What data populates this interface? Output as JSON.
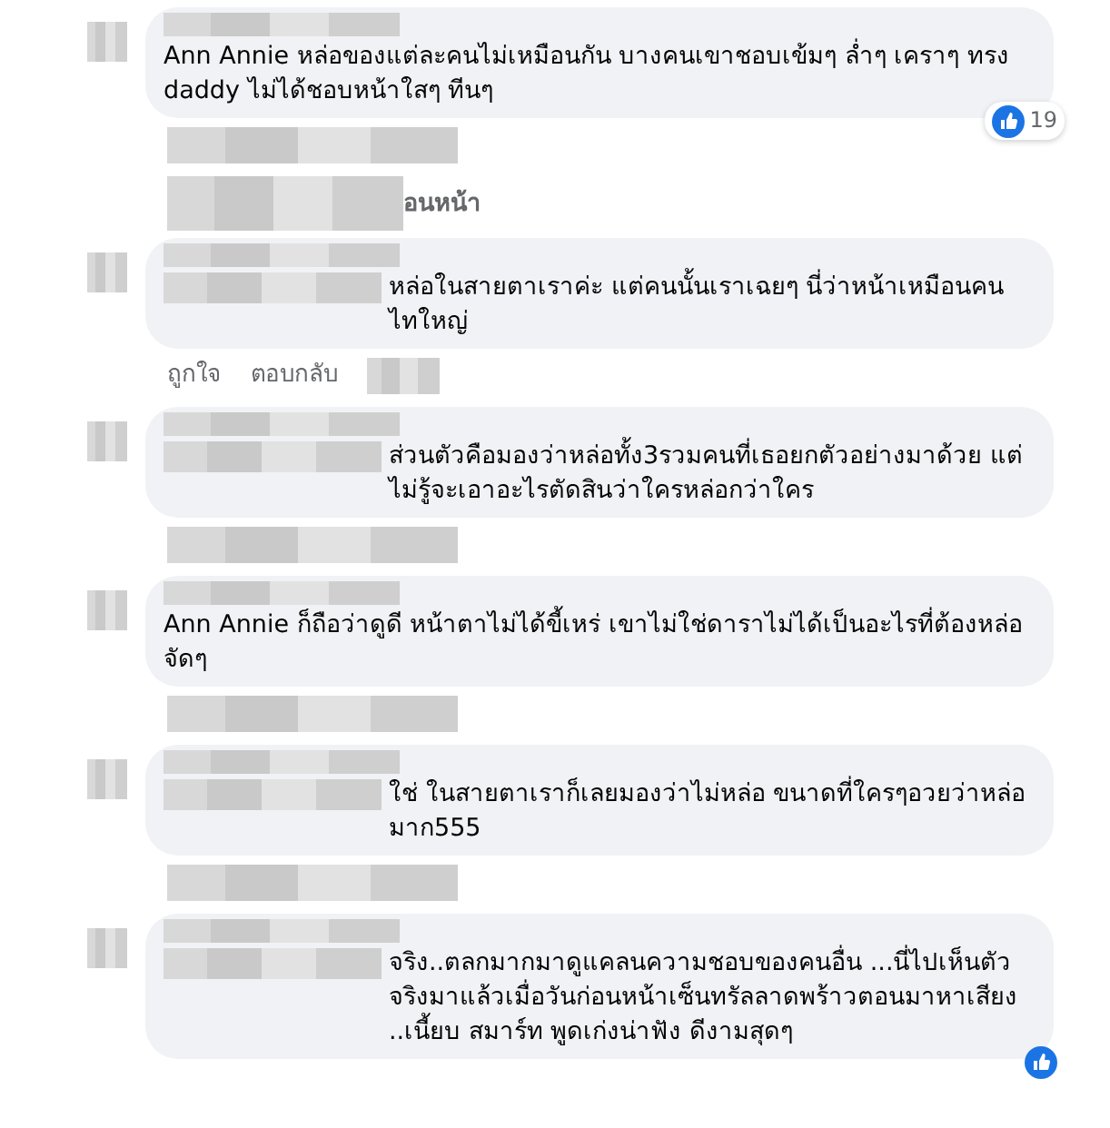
{
  "comments": [
    {
      "author_blurred": true,
      "mention": "Ann Annie",
      "text": "หล่อของแต่ละคนไม่เหมือนกัน บางคนเขาชอบเข้มๆ ล่ำๆ เคราๆ ทรง daddy ไม่ได้ชอบหน้าใสๆ ทีนๆ",
      "reaction": {
        "kind": "like",
        "count": "19"
      },
      "after": {
        "kind": "blurred"
      }
    },
    {
      "kind": "more",
      "text": "อนหน้า"
    },
    {
      "author_blurred": true,
      "mention_blurred": true,
      "text": "หล่อในสายตาเราค่ะ แต่คนนั้นเราเฉยๆ นี่ว่าหน้าเหมือนคนไทใหญ่",
      "after": {
        "kind": "actions",
        "items": [
          "ถูกใจ",
          "ตอบกลับ"
        ]
      }
    },
    {
      "author_blurred": true,
      "mention_blurred": true,
      "text": "ส่วนตัวคือมองว่าหล่อทั้ง3รวมคนที่เธอยกตัวอย่างมาด้วย แต่ไม่รู้จะเอาอะไรตัดสินว่าใครหล่อกว่าใคร",
      "after": {
        "kind": "blurred"
      }
    },
    {
      "author_blurred": true,
      "mention": "Ann Annie",
      "text": "ก็ถือว่าดูดี หน้าตาไม่ได้ขี้เหร่ เขาไม่ใช่ดาราไม่ได้เป็นอะไรที่ต้องหล่อจัดๆ",
      "after": {
        "kind": "blurred"
      }
    },
    {
      "author_blurred": true,
      "mention_blurred": true,
      "text": "ใช่ ในสายตาเราก็เลยมองว่าไม่หล่อ ขนาดที่ใครๆอวยว่าหล่อมาก555",
      "after": {
        "kind": "blurred"
      }
    },
    {
      "author_blurred": true,
      "mention_blurred": true,
      "text": "จริง..ตลกมากมาดูแคลนความชอบของคนอื่น ...นี่ไปเห็นตัวจริงมาแล้วเมื่อวันก่อนหน้าเซ็นทรัลลาดพร้าวตอนมาหาเสียง ..เนี้ยบ สมาร์ท พูดเก่งน่าฟัง ดีงามสุดๆ",
      "reaction": {
        "kind": "like"
      }
    }
  ]
}
